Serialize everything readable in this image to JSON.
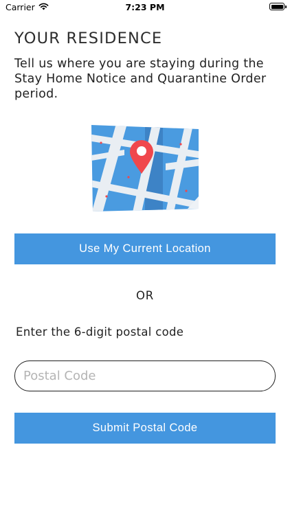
{
  "status_bar": {
    "carrier": "Carrier",
    "time": "7:23 PM"
  },
  "screen": {
    "title": "YOUR RESIDENCE",
    "intro": "Tell us where you are staying during the Stay Home Notice and Quarantine Order period."
  },
  "illustration": {
    "icon": "map-pin-illustration",
    "colors": {
      "map": "#4a9be0",
      "road": "#e9eef3",
      "pin": "#f0474c"
    }
  },
  "actions": {
    "use_location_label": "Use My Current Location",
    "or_label": "OR",
    "postal_prompt": "Enter the 6-digit postal code",
    "postal_placeholder": "Postal Code",
    "postal_value": "",
    "submit_label": "Submit Postal Code"
  },
  "colors": {
    "accent": "#4496df",
    "text": "#222222"
  }
}
